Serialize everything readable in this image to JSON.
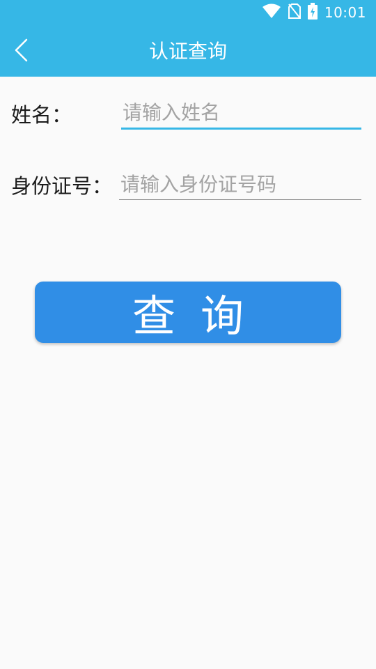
{
  "status_bar": {
    "time": "10:01",
    "icons": [
      "wifi-icon",
      "no-sim-icon",
      "battery-charging-icon"
    ]
  },
  "header": {
    "title": "认证查询",
    "back_icon": "chevron-left-icon"
  },
  "form": {
    "name": {
      "label": "姓名：",
      "value": "",
      "placeholder": "请输入姓名"
    },
    "id_number": {
      "label": "身份证号：",
      "value": "",
      "placeholder": "请输入身份证号码"
    }
  },
  "actions": {
    "query_label": "查询"
  },
  "colors": {
    "header_bg": "#36b7e6",
    "button_bg": "#308ee6",
    "focused_underline": "#36b7e6",
    "underline": "#8a8a8a",
    "background": "#fafafa"
  }
}
